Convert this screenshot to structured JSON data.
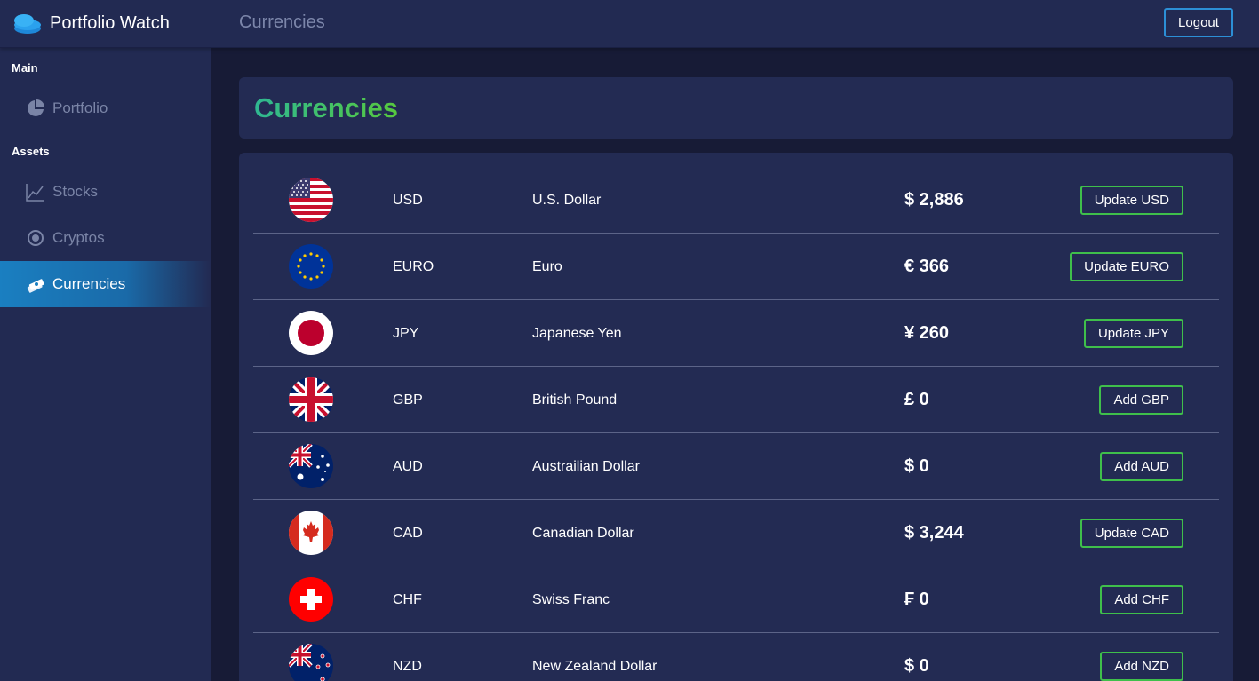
{
  "app": {
    "name": "Portfolio Watch",
    "logo_icon": "coins-stack-icon"
  },
  "header": {
    "crumb": "Currencies",
    "logout_label": "Logout"
  },
  "sidebar": {
    "sections": [
      {
        "label": "Main"
      },
      {
        "label": "Assets"
      }
    ],
    "items": [
      {
        "label": "Portfolio",
        "icon": "pie-chart-icon"
      },
      {
        "label": "Stocks",
        "icon": "line-chart-icon"
      },
      {
        "label": "Cryptos",
        "icon": "crypto-coin-icon"
      },
      {
        "label": "Currencies",
        "icon": "money-stack-icon",
        "active": true
      }
    ]
  },
  "page": {
    "title": "Currencies"
  },
  "currencies": [
    {
      "code": "USD",
      "name": "U.S. Dollar",
      "amount": "$ 2,886",
      "action": "Update USD",
      "flag": "us-flag-icon"
    },
    {
      "code": "EURO",
      "name": "Euro",
      "amount": "€ 366",
      "action": "Update EURO",
      "flag": "eu-flag-icon"
    },
    {
      "code": "JPY",
      "name": "Japanese Yen",
      "amount": "¥ 260",
      "action": "Update JPY",
      "flag": "japan-flag-icon"
    },
    {
      "code": "GBP",
      "name": "British Pound",
      "amount": "£ 0",
      "action": "Add GBP",
      "flag": "uk-flag-icon"
    },
    {
      "code": "AUD",
      "name": "Austrailian Dollar",
      "amount": "$ 0",
      "action": "Add AUD",
      "flag": "australia-flag-icon"
    },
    {
      "code": "CAD",
      "name": "Canadian Dollar",
      "amount": "$ 3,244",
      "action": "Update CAD",
      "flag": "canada-flag-icon"
    },
    {
      "code": "CHF",
      "name": "Swiss Franc",
      "amount": "₣ 0",
      "action": "Add CHF",
      "flag": "switzerland-flag-icon"
    },
    {
      "code": "NZD",
      "name": "New Zealand Dollar",
      "amount": "$ 0",
      "action": "Add NZD",
      "flag": "new-zealand-flag-icon"
    }
  ],
  "colors": {
    "accent_blue": "#2c8fd6",
    "accent_green": "#3fbf4b",
    "title_gradient_start": "#2fb892",
    "title_gradient_end": "#57c93e"
  }
}
